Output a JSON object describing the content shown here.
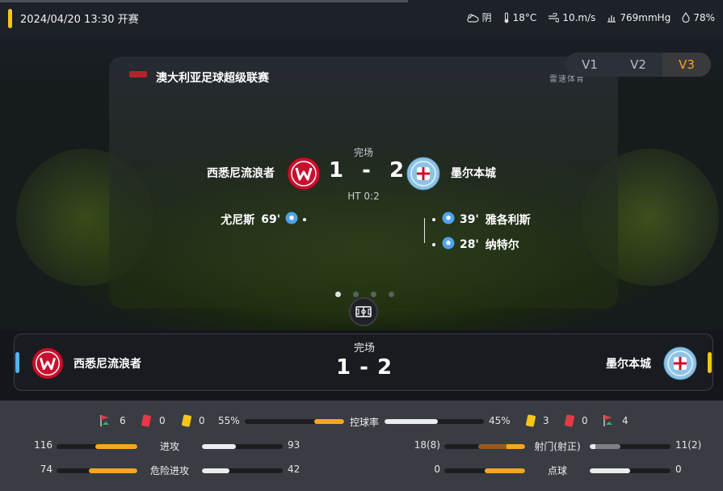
{
  "topbar": {
    "datetime": "2024/04/20 13:30 开赛",
    "weather": {
      "condition": "阴",
      "temperature": "18°C",
      "wind": "10.m/s",
      "pressure": "769mmHg",
      "humidity": "78%"
    }
  },
  "version_tabs": [
    "V1",
    "V2",
    "V3"
  ],
  "active_version": "V3",
  "match": {
    "league": "澳大利亚足球超级联赛",
    "brand": "雷速体育",
    "status": "完场",
    "home_team": "西悉尼流浪者",
    "away_team": "墨尔本城",
    "home_score": "1",
    "separator": "-",
    "away_score": "2",
    "halftime": "HT 0:2",
    "home_goals": [
      {
        "player": "尤尼斯",
        "minute": "69'"
      }
    ],
    "away_goals": [
      {
        "minute": "39'",
        "player": "雅各利斯"
      },
      {
        "minute": "28'",
        "player": "纳特尔"
      }
    ]
  },
  "pager": {
    "count": 4,
    "active": 0
  },
  "scorecard": {
    "status": "完场",
    "score": "1 - 2",
    "home_team": "西悉尼流浪者",
    "away_team": "墨尔本城"
  },
  "colors": {
    "accent": "#f5a623",
    "home_accent": "#4fb3ec",
    "away_accent": "#f5c518",
    "home_badge_red": "#c8102e",
    "away_badge_blue": "#8ec3e6"
  },
  "stats": {
    "home_corners": "6",
    "home_red": "0",
    "home_yellow": "0",
    "possession_label": "控球率",
    "home_possession": "55%",
    "away_possession": "45%",
    "home_possession_value": 55,
    "away_possession_value": 45,
    "away_yellow": "3",
    "away_red": "0",
    "away_corners": "4",
    "left": [
      {
        "label": "进攻",
        "home": "116",
        "away": "93",
        "home_value": 116,
        "away_value": 93
      },
      {
        "label": "危险进攻",
        "home": "74",
        "away": "42",
        "home_value": 74,
        "away_value": 42
      }
    ],
    "right": [
      {
        "label": "射门(射正)",
        "home": "18(8)",
        "away": "11(2)",
        "home_value": 18,
        "home_sub": 8,
        "away_value": 11,
        "away_sub": 2
      },
      {
        "label": "点球",
        "home": "0",
        "away": "0",
        "home_value": 0,
        "away_value": 0
      }
    ]
  }
}
